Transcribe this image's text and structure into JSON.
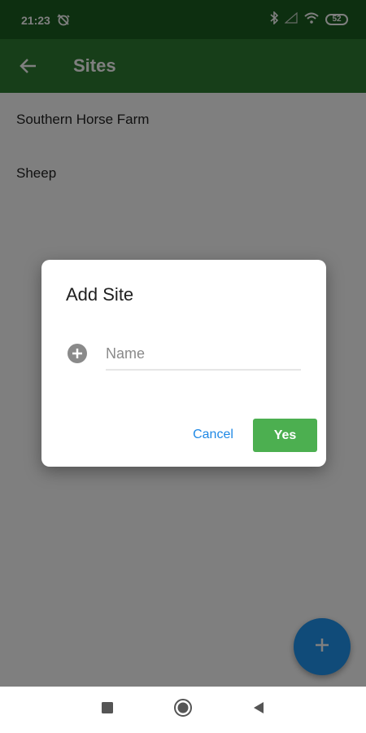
{
  "status_bar": {
    "time": "21:23",
    "alarm_icon": "alarm-off-icon",
    "battery_level": "52",
    "icons": [
      "bluetooth-icon",
      "signal-icon",
      "wifi-icon",
      "battery-icon"
    ]
  },
  "app_bar": {
    "title": "Sites",
    "back_icon": "arrow-back-icon",
    "background_color": "#2e7d32"
  },
  "sites": [
    {
      "label": "Southern Horse Farm"
    },
    {
      "label": "Sheep"
    }
  ],
  "dialog": {
    "title": "Add Site",
    "name_placeholder": "Name",
    "name_value": "",
    "cancel_label": "Cancel",
    "yes_label": "Yes",
    "yes_color": "#4caf50",
    "cancel_color": "#1e88e5"
  },
  "fab": {
    "icon": "plus-icon",
    "color": "#2196f3"
  },
  "nav_bar": {
    "icons": [
      "recent-apps-icon",
      "home-icon",
      "back-icon"
    ]
  }
}
